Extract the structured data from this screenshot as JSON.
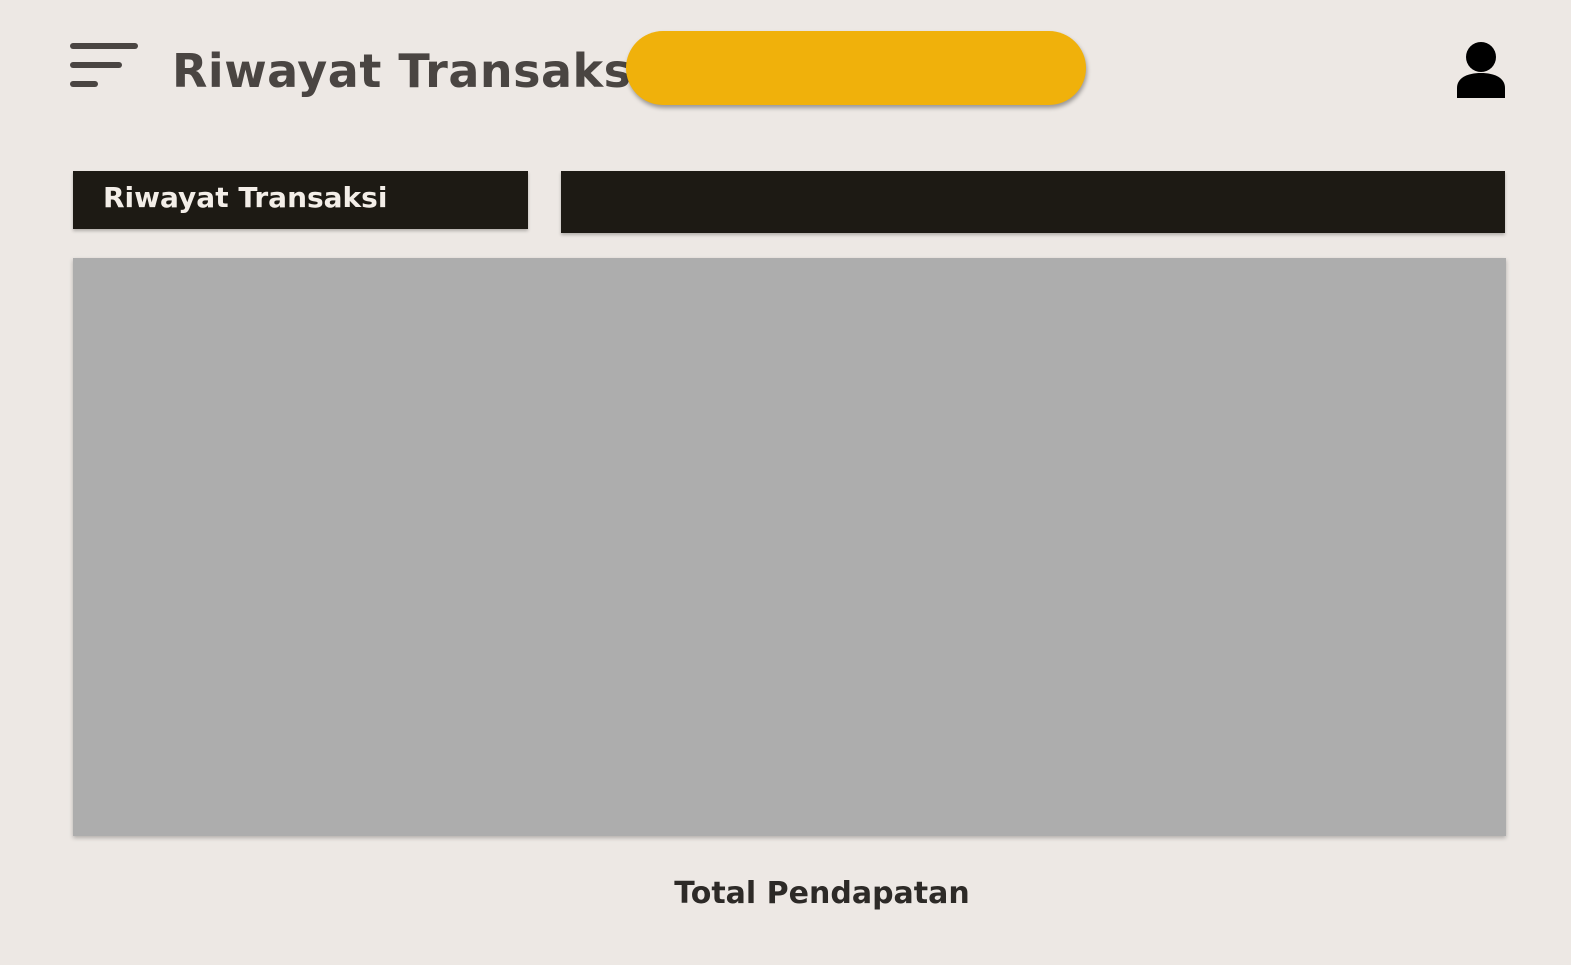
{
  "header": {
    "menu_icon": "hamburger-menu-icon",
    "title": "Riwayat Transaksi",
    "user_icon": "user-icon"
  },
  "section": {
    "label": "Riwayat Transaksi"
  },
  "footer": {
    "total_label": "Total Pendapatan"
  },
  "colors": {
    "background": "#ede8e4",
    "accent": "#f0b10b",
    "dark_bar": "#1d1a14",
    "panel": "#adadad",
    "title_text": "#4a4542"
  }
}
